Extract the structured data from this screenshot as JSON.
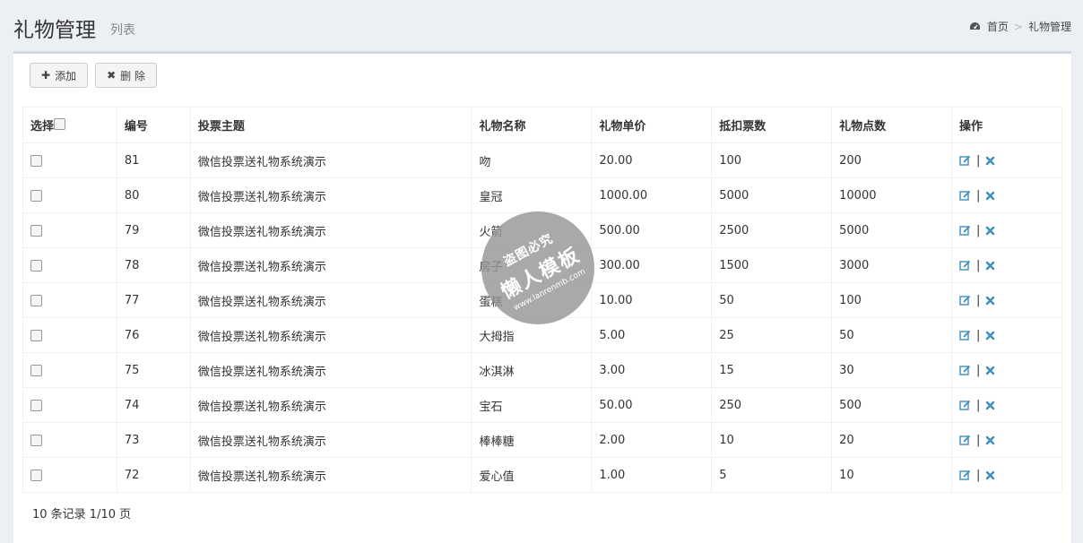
{
  "header": {
    "title": "礼物管理",
    "subtitle": "列表",
    "breadcrumb": {
      "home": "首页",
      "separator": ">",
      "current": "礼物管理",
      "home_icon": "dashboard-icon"
    }
  },
  "toolbar": {
    "add_label": "添加",
    "delete_label": "删 除"
  },
  "table": {
    "columns": [
      "选择",
      "编号",
      "投票主题",
      "礼物名称",
      "礼物单价",
      "抵扣票数",
      "礼物点数",
      "操作"
    ],
    "rows": [
      {
        "id": "81",
        "topic": "微信投票送礼物系统演示",
        "name": "吻",
        "price": "20.00",
        "votes": "100",
        "points": "200"
      },
      {
        "id": "80",
        "topic": "微信投票送礼物系统演示",
        "name": "皇冠",
        "price": "1000.00",
        "votes": "5000",
        "points": "10000"
      },
      {
        "id": "79",
        "topic": "微信投票送礼物系统演示",
        "name": "火箭",
        "price": "500.00",
        "votes": "2500",
        "points": "5000"
      },
      {
        "id": "78",
        "topic": "微信投票送礼物系统演示",
        "name": "房子",
        "price": "300.00",
        "votes": "1500",
        "points": "3000"
      },
      {
        "id": "77",
        "topic": "微信投票送礼物系统演示",
        "name": "蛋糕",
        "price": "10.00",
        "votes": "50",
        "points": "100"
      },
      {
        "id": "76",
        "topic": "微信投票送礼物系统演示",
        "name": "大拇指",
        "price": "5.00",
        "votes": "25",
        "points": "50"
      },
      {
        "id": "75",
        "topic": "微信投票送礼物系统演示",
        "name": "冰淇淋",
        "price": "3.00",
        "votes": "15",
        "points": "30"
      },
      {
        "id": "74",
        "topic": "微信投票送礼物系统演示",
        "name": "宝石",
        "price": "50.00",
        "votes": "250",
        "points": "500"
      },
      {
        "id": "73",
        "topic": "微信投票送礼物系统演示",
        "name": "棒棒糖",
        "price": "2.00",
        "votes": "10",
        "points": "20"
      },
      {
        "id": "72",
        "topic": "微信投票送礼物系统演示",
        "name": "爱心值",
        "price": "1.00",
        "votes": "5",
        "points": "10"
      }
    ],
    "op_separator": "|"
  },
  "footer": {
    "summary": "10 条记录 1/10 页"
  },
  "watermark": {
    "line1": "盗图必究",
    "line2": "懒人模板",
    "line3": "www.lanrenmb.com"
  },
  "colors": {
    "background": "#ecf0f5",
    "box_border": "#d2d6de",
    "edit_icon": "#3c8dbc",
    "delete_icon": "#3c8dbc"
  }
}
